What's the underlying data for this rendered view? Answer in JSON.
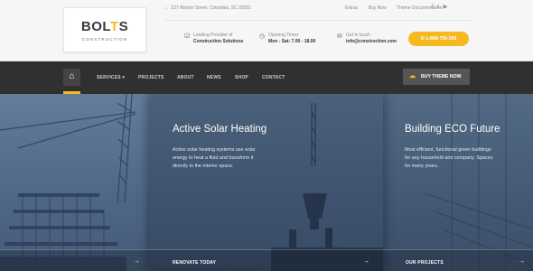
{
  "logo": {
    "text_main": "BOL",
    "text_accent": "T",
    "text_end": "S",
    "subtitle": "CONSTRUCTION"
  },
  "header": {
    "address_icon": "home-icon",
    "address": "237 Marion Street, Columbia, SC 29201",
    "links": [
      "Extras",
      "Buy Now",
      "Theme Documentation"
    ],
    "social": [
      "facebook-icon",
      "twitter-icon",
      "youtube-icon"
    ]
  },
  "info": [
    {
      "icon": "check-icon",
      "line1": "Leading Provider of",
      "line2": "Construction Solutions"
    },
    {
      "icon": "clock-icon",
      "line1": "Opening Times",
      "line2": "Mon - Sat: 7.00 - 18.00"
    },
    {
      "icon": "mail-icon",
      "line1": "Get in touch",
      "line2": "info@construction.com"
    }
  ],
  "call": {
    "label": "1-888-756-266"
  },
  "nav": {
    "items": [
      "SERVICES ▾",
      "PROJECTS",
      "ABOUT",
      "NEWS",
      "SHOP",
      "CONTACT"
    ],
    "buy_label": "BUY THEME NOW"
  },
  "hero": {
    "panels": [
      {
        "title": "",
        "text": [],
        "cta": ""
      },
      {
        "title": "Active Solar Heating",
        "text": [
          "Active solar heating systems use solar",
          "energy to heat a fluid and transform it",
          "directly to the interior space."
        ],
        "cta": "RENOVATE TODAY"
      },
      {
        "title": "Building ECO Future",
        "text": [
          "Most efficient, functional green buildings",
          "for any household and company. Spaces",
          "for many years."
        ],
        "cta": "OUR PROJECTS"
      }
    ],
    "arrow": "→"
  },
  "colors": {
    "accent": "#f6b91f",
    "nav_bg": "#303030",
    "topbar_bg": "#f6f6f6"
  }
}
